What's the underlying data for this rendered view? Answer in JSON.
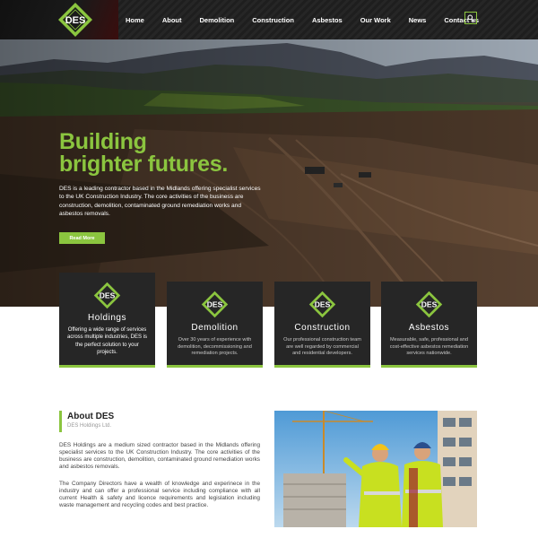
{
  "brand": {
    "logo_text": "DES",
    "accent_color": "#8bc53f",
    "dark_color": "#262626"
  },
  "nav": {
    "items": [
      "Home",
      "About",
      "Demolition",
      "Construction",
      "Asbestos",
      "Our Work",
      "News",
      "Contact us"
    ],
    "search_icon": "search-icon"
  },
  "hero": {
    "title_line1": "Building",
    "title_line2": "brighter futures.",
    "text": "DES is a leading contractor based in the Midlands offering specialist services to the UK Construction Industry. The core activities of the business are construction, demolition, contaminated ground remediation works and asbestos removals.",
    "button_label": "Read More"
  },
  "services": [
    {
      "title": "Holdings",
      "text": "Offering a wide range of services across multiple industries, DES is the perfect solution to your projects."
    },
    {
      "title": "Demolition",
      "text": "Over 30 years of experience with demolition, decommissioning and remediation projects."
    },
    {
      "title": "Construction",
      "text": "Our professional construction team are well regarded by commercial and residential developers."
    },
    {
      "title": "Asbestos",
      "text": "Measurable, safe, professional and cost-effective asbestos remediation services nationwide."
    }
  ],
  "about": {
    "title": "About DES",
    "subtitle": "DES Holdings Ltd.",
    "paragraph1": "DES Holdings are a medium sized contractor based in the Midlands offering specialist services to the UK Construction Industry. The core activities of the business are construction, demolition, contaminated ground remediation works and asbestos removals.",
    "paragraph2": "The Company Directors have a wealth of knowledge and experinece in the industry and can offer a professional service including compliance with all current Health & safety and licence requirements and legislation including waste management and recycling codes and best practice."
  }
}
